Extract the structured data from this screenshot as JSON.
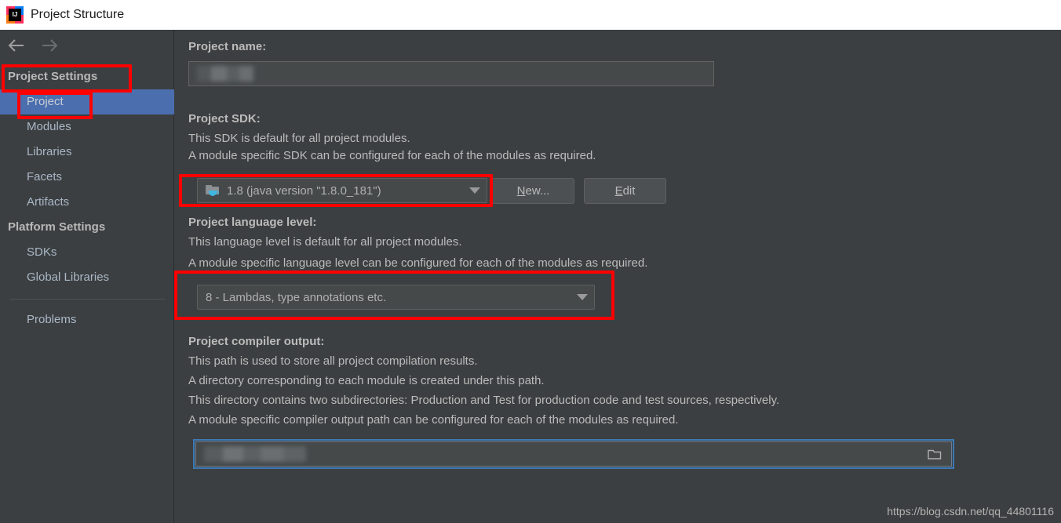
{
  "window": {
    "title": "Project Structure",
    "logo_text": "IJ",
    "logo_icon": "intellij-idea-logo"
  },
  "sidebar": {
    "nav": {
      "back_icon": "arrow-left-icon",
      "forward_icon": "arrow-right-icon"
    },
    "groups": [
      {
        "label": "Project Settings",
        "items": [
          {
            "label": "Project",
            "selected": true
          },
          {
            "label": "Modules",
            "selected": false
          },
          {
            "label": "Libraries",
            "selected": false
          },
          {
            "label": "Facets",
            "selected": false
          },
          {
            "label": "Artifacts",
            "selected": false
          }
        ]
      },
      {
        "label": "Platform Settings",
        "items": [
          {
            "label": "SDKs",
            "selected": false
          },
          {
            "label": "Global Libraries",
            "selected": false
          }
        ]
      }
    ],
    "problems_label": "Problems"
  },
  "main": {
    "project_name": {
      "title": "Project name:",
      "value": "",
      "redacted": true
    },
    "project_sdk": {
      "title": "Project SDK:",
      "desc_lines": [
        "This SDK is default for all project modules.",
        "A module specific SDK can be configured for each of the modules as required."
      ],
      "selected": "1.8 (java version \"1.8.0_181\")",
      "sdk_icon": "java-sdk-folder-icon",
      "dropdown_icon": "chevron-down-icon",
      "new_button": {
        "prefix": "N",
        "rest": "ew..."
      },
      "edit_button": {
        "prefix": "E",
        "rest": "dit"
      }
    },
    "language_level": {
      "title": "Project language level:",
      "desc_lines": [
        "This language level is default for all project modules.",
        "A module specific language level can be configured for each of the modules as required."
      ],
      "selected": "8 - Lambdas, type annotations etc.",
      "dropdown_icon": "chevron-down-icon"
    },
    "compiler_output": {
      "title": "Project compiler output:",
      "desc_lines": [
        "This path is used to store all project compilation results.",
        "A directory corresponding to each module is created under this path.",
        "This directory contains two subdirectories: Production and Test for production code and test sources, respectively.",
        "A module specific compiler output path can be configured for each of the modules as required."
      ],
      "value": "",
      "redacted": true,
      "browse_icon": "folder-browse-icon"
    },
    "watermark": "https://blog.csdn.net/qq_44801116"
  },
  "annotations": {
    "color": "#fe0000",
    "boxes": [
      {
        "name": "project-settings-highlight"
      },
      {
        "name": "project-item-highlight"
      },
      {
        "name": "sdk-combo-highlight"
      },
      {
        "name": "language-level-combo-highlight"
      }
    ]
  },
  "theme": {
    "background": "#3c3f41",
    "selection": "#4b6eaf",
    "text": "#bbbbbb",
    "tree_text": "#a9b7c6",
    "field_background": "#45494a",
    "focus_ring": "#3d7ab5"
  }
}
